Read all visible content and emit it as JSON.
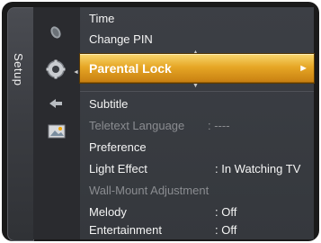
{
  "sidebar": {
    "tab_label": "Setup"
  },
  "menu": {
    "items": [
      {
        "label": "Time",
        "value": ""
      },
      {
        "label": "Change PIN",
        "value": ""
      },
      {
        "label": "Parental Lock",
        "value": "",
        "arrow": "►"
      },
      {
        "label": "Subtitle",
        "value": ""
      },
      {
        "label": "Teletext Language",
        "value": ": ----"
      },
      {
        "label": "Preference",
        "value": ""
      },
      {
        "label": "Light Effect",
        "value": ": In Watching TV"
      },
      {
        "label": "Wall-Mount Adjustment",
        "value": ""
      },
      {
        "label": "Melody",
        "value": ": Off"
      },
      {
        "label": "Entertainment",
        "value": ": Off"
      }
    ],
    "scroll_up": "▲",
    "scroll_down": "▼"
  },
  "colors": {
    "highlight_top": "#f7d36a",
    "highlight_bottom": "#c98112",
    "menu_bg": "#3a3d42",
    "disabled_text": "#8a8c90"
  },
  "icons": [
    "satellite-icon",
    "gear-icon",
    "arrow-icon",
    "image-icon"
  ]
}
